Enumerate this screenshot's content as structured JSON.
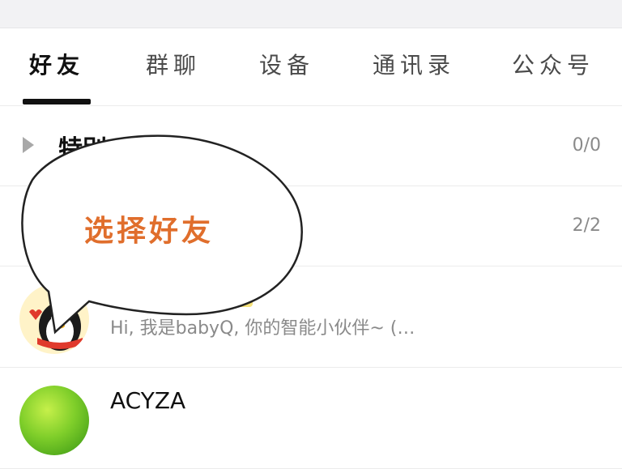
{
  "tabs": [
    {
      "label": "好友",
      "active": true
    },
    {
      "label": "群聊",
      "active": false
    },
    {
      "label": "设备",
      "active": false
    },
    {
      "label": "通讯录",
      "active": false
    },
    {
      "label": "公众号",
      "active": false
    }
  ],
  "groups": [
    {
      "name": "特别",
      "count": "0/0"
    },
    {
      "name": "",
      "count": "2/2"
    }
  ],
  "contacts": [
    {
      "name": "",
      "message": "Hi, 我是babyQ, 你的智能小伙伴~ (…"
    },
    {
      "name": "ACYZA",
      "message": ""
    }
  ],
  "annotation": {
    "text": "选择好友"
  },
  "colors": {
    "accent_text": "#e06e2c",
    "tab_underline": "#111111",
    "muted_text": "#8a8a8a"
  }
}
